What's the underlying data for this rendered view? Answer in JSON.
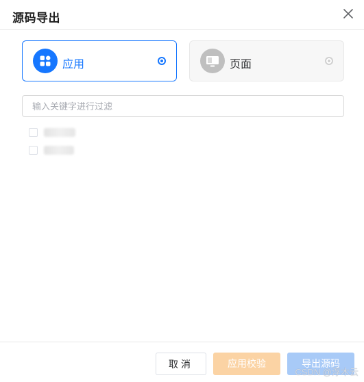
{
  "dialog": {
    "title": "源码导出",
    "close_icon": "close-icon"
  },
  "export_type": {
    "selected": "app",
    "options": [
      {
        "id": "app",
        "label": "应用",
        "icon": "app-grid-icon",
        "selected": true,
        "accent": "#1677ff"
      },
      {
        "id": "page",
        "label": "页面",
        "icon": "page-monitor-icon",
        "selected": false,
        "accent": "#bfbfbf"
      }
    ]
  },
  "search": {
    "placeholder": "输入关键字进行过滤",
    "value": ""
  },
  "tree": {
    "items": [
      {
        "label": "",
        "checked": false,
        "redacted": true
      },
      {
        "label": "",
        "checked": false,
        "redacted": true
      }
    ]
  },
  "footer": {
    "cancel_label": "取消",
    "check_label": "应用校验",
    "export_label": "导出源码",
    "colors": {
      "check_bg": "#fbd3a4",
      "export_bg": "#a8caf7"
    }
  },
  "watermark": "CSDN @浮木云"
}
